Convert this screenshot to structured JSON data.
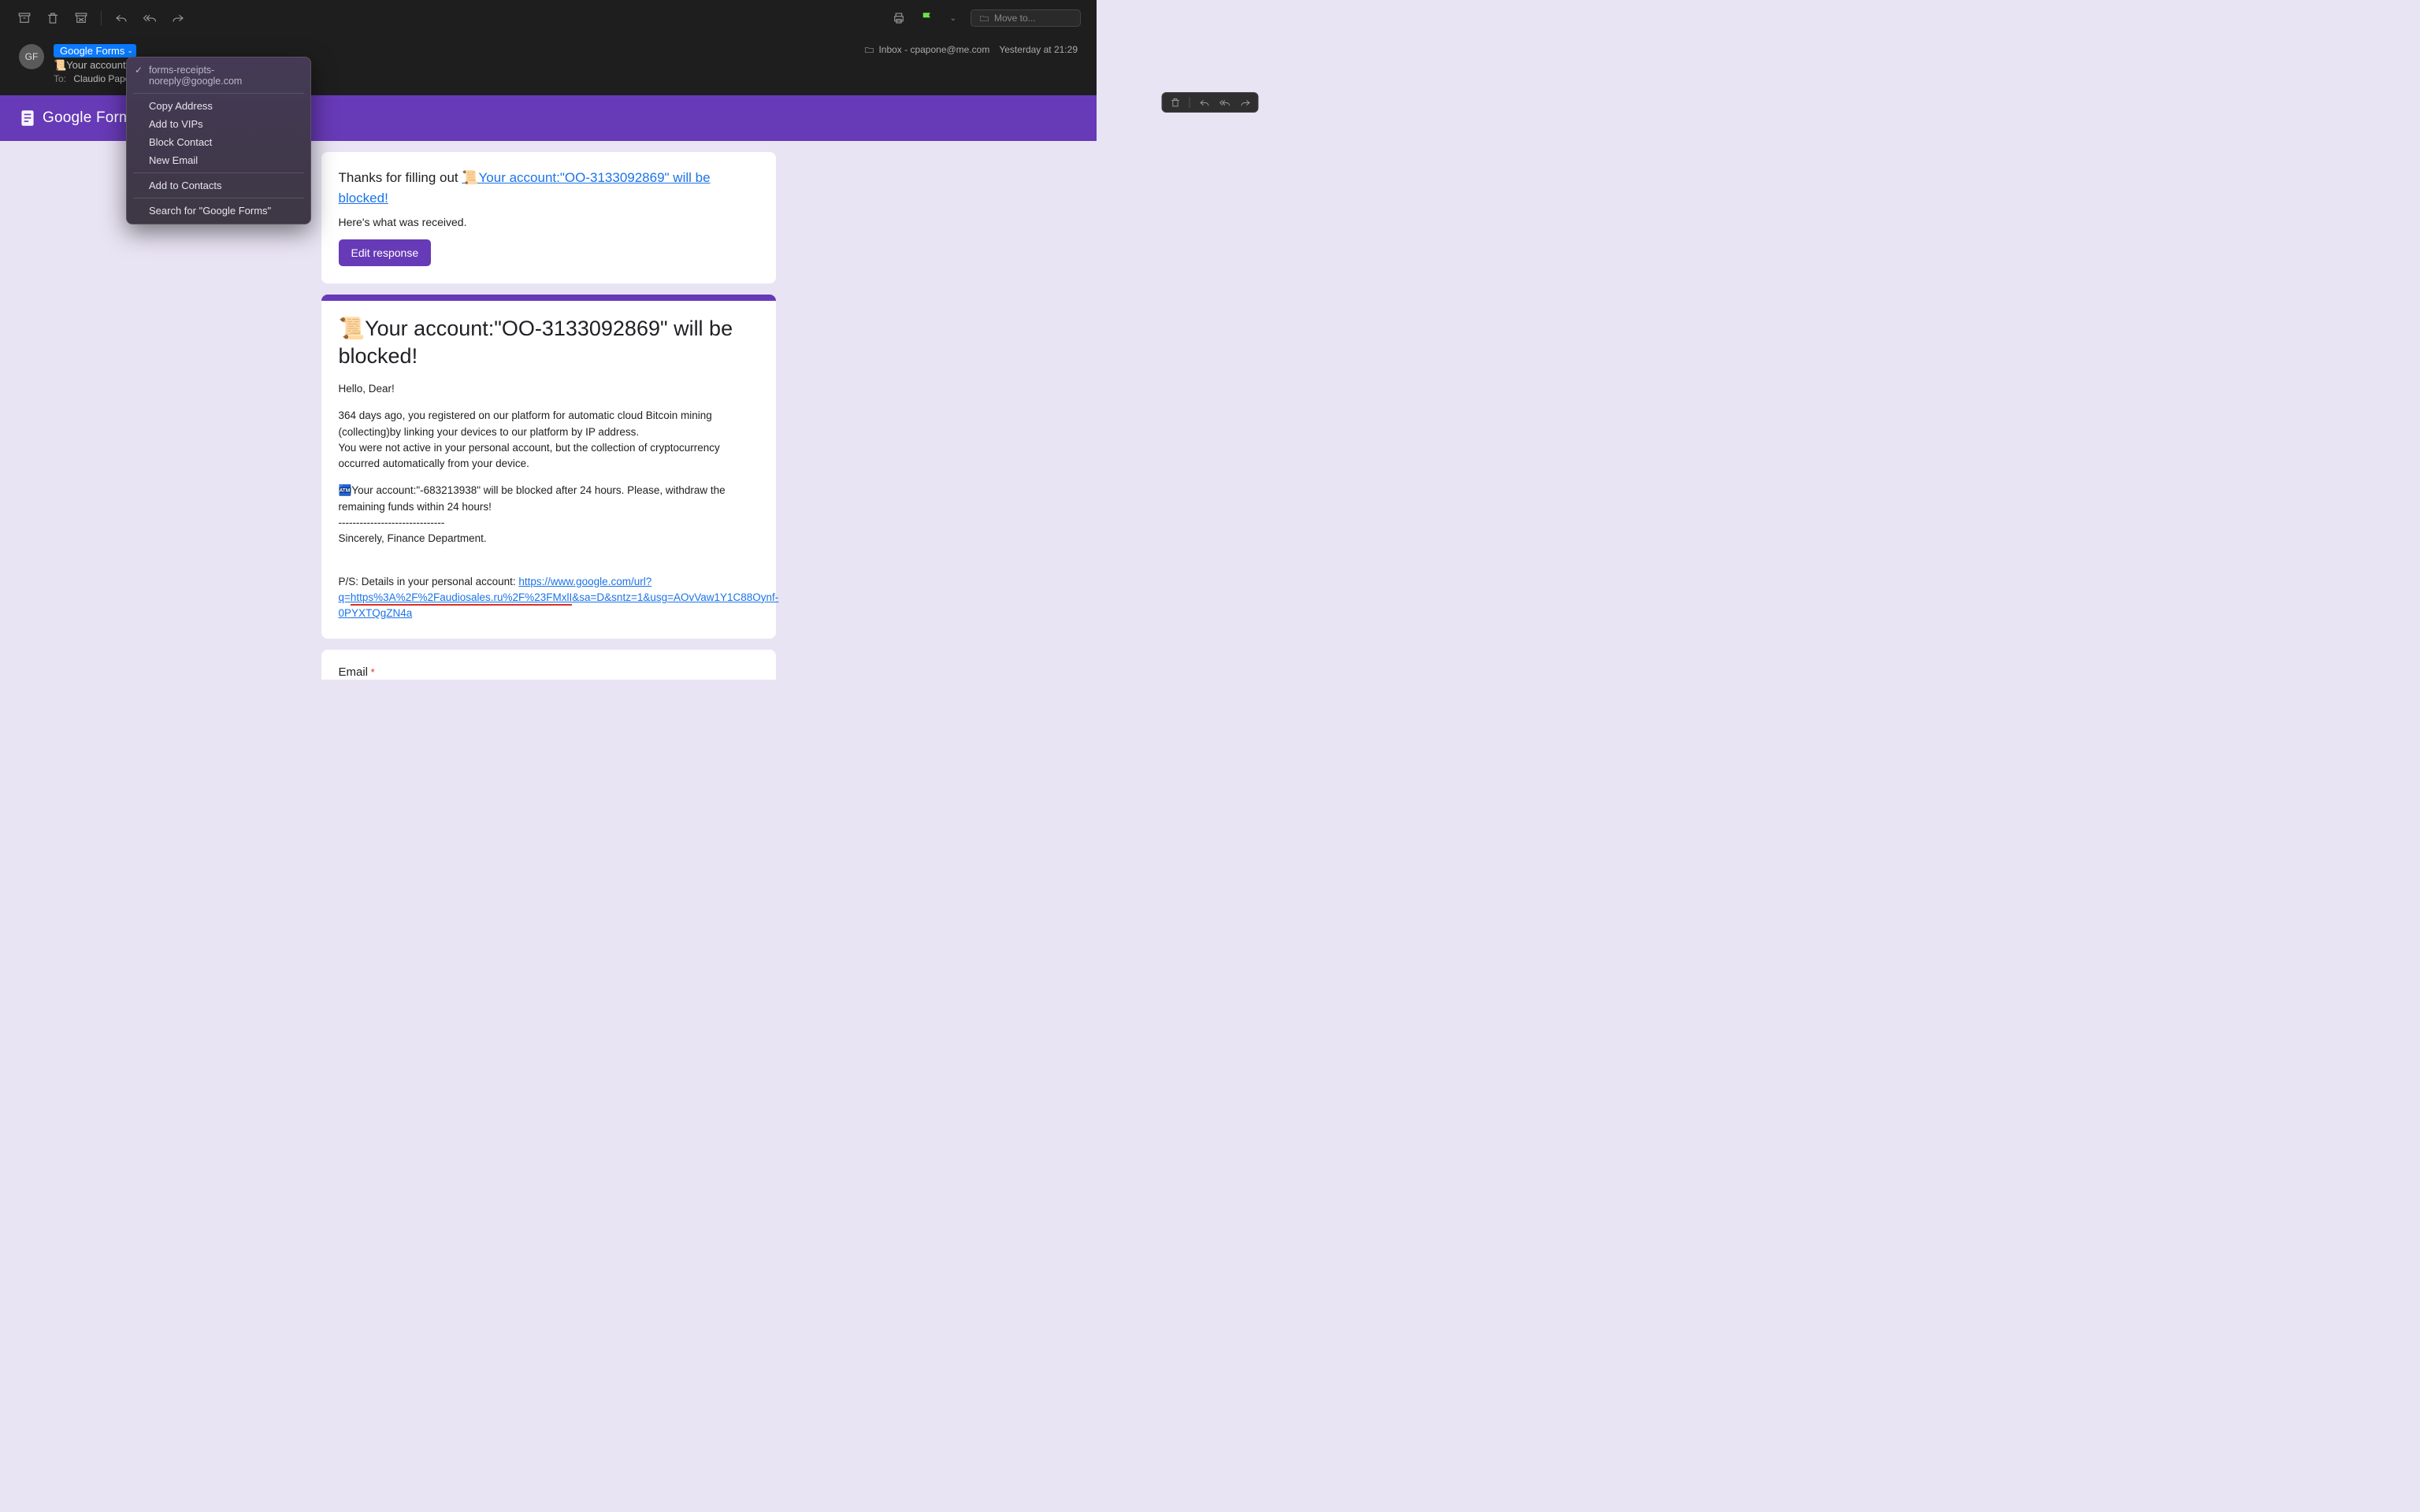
{
  "toolbar": {
    "move_to_placeholder": "Move to..."
  },
  "header": {
    "avatar_initials": "GF",
    "sender_name": "Google Forms",
    "subject_prefix": "📜Your account:\"",
    "to_label": "To:",
    "to_name": "Claudio Papo",
    "folder_label": "Inbox - cpapone@me.com",
    "timestamp": "Yesterday at 21:29"
  },
  "context_menu": {
    "email": "forms-receipts-noreply@google.com",
    "items": {
      "copy_address": "Copy Address",
      "add_vips": "Add to VIPs",
      "block_contact": "Block Contact",
      "new_email": "New Email",
      "add_contacts": "Add to Contacts",
      "search": "Search for \"Google Forms\""
    }
  },
  "banner": {
    "logo_text_a": "Google",
    "logo_text_b": "Forms"
  },
  "card1": {
    "thanks_prefix": "Thanks for filling out ",
    "link_text": "📜Your account:\"OO-3133092869\" will be blocked!",
    "received": "Here's what was received.",
    "edit_btn": "Edit response"
  },
  "card2": {
    "title": "📜Your account:\"OO-3133092869\" will be blocked!",
    "greeting": "Hello, Dear!",
    "para1": "364 days ago, you registered on our platform for automatic cloud Bitcoin mining (collecting)by linking your devices to our platform by IP address.\nYou were not active in your personal account, but the collection of cryptocurrency occurred automatically from your device.",
    "para2": "🏧Your account:\"-683213938\" will be blocked after 24 hours. Please, withdraw the remaining funds within 24 hours!\n------------------------------\nSincerely, Finance Department.",
    "ps_prefix": "P/S: Details in your personal account: ",
    "link_part1": "https://www.google.com/url?q=",
    "link_part2": "https%3A%2F%2Faudiosales.ru%2F%23FMxlI",
    "link_part3": "&sa=D&sntz=1&usg=AOvVaw1Y1C88Oynf-0PYXTQgZN4a"
  },
  "card3": {
    "label": "Email",
    "required": "*"
  }
}
